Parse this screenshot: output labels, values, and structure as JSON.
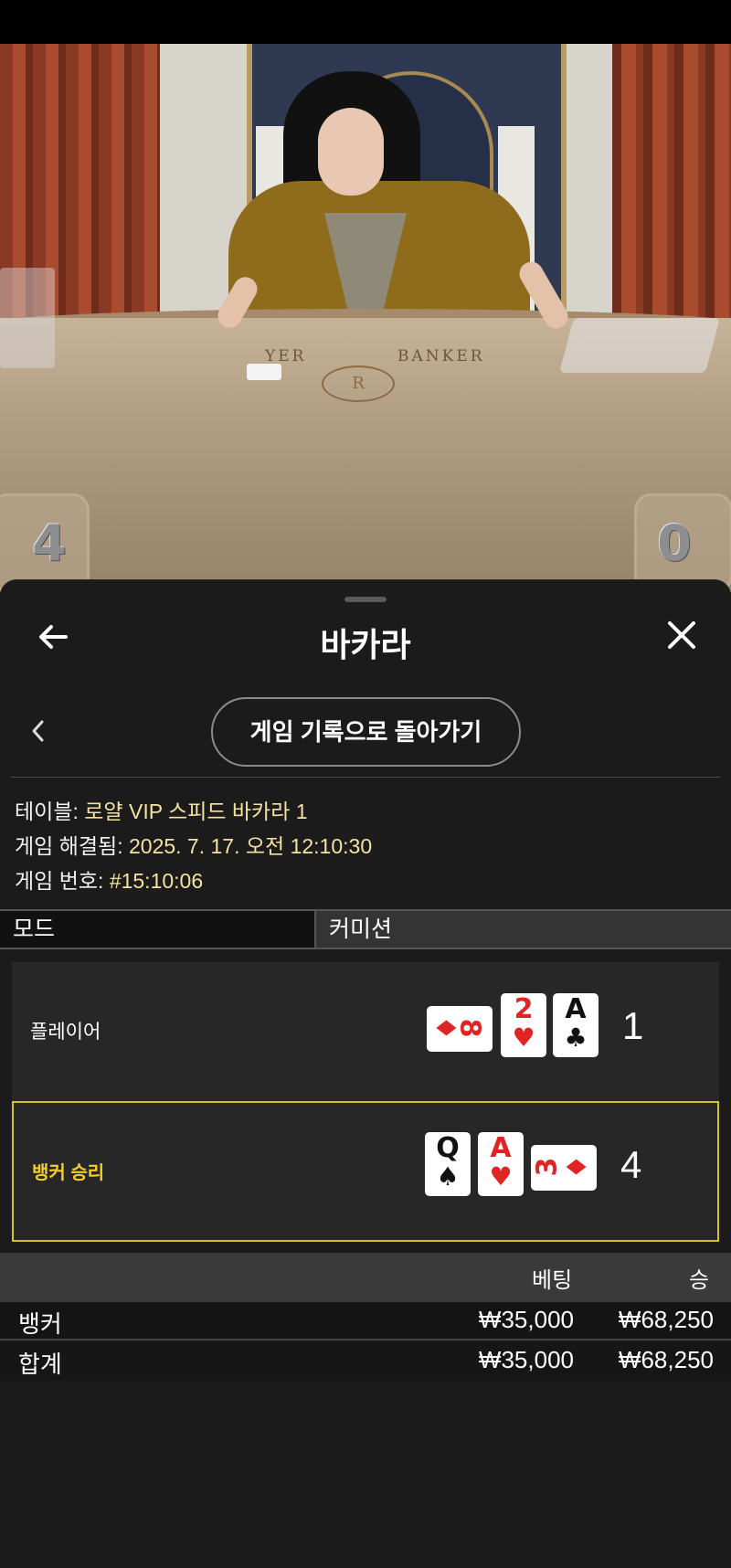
{
  "video": {
    "felt_player_label": "YER",
    "felt_banker_label": "BANKER",
    "felt_logo": "R",
    "left_score": "4",
    "right_score": "0"
  },
  "header": {
    "title": "바카라",
    "back_icon": "arrow-left-icon",
    "close_icon": "close-icon"
  },
  "history": {
    "button_label": "게임 기록으로 돌아가기",
    "chevron_icon": "chevron-left-icon"
  },
  "info": {
    "table_label": "테이블: ",
    "table_value": "로얄 VIP 스피드 바카라 1",
    "resolved_label": "게임 해결됨: ",
    "resolved_value": "2025. 7. 17. 오전 12:10:30",
    "game_no_label": "게임 번호: ",
    "game_no_value": "#15:10:06"
  },
  "mode": {
    "label": "모드",
    "value": "커미션"
  },
  "hands": {
    "player": {
      "label": "플레이어",
      "total": "1",
      "cards": [
        {
          "rank": "8",
          "suit": "♦",
          "color": "#e02424",
          "orientation": "sideways"
        },
        {
          "rank": "2",
          "suit": "♥",
          "color": "#e02424",
          "orientation": "upright"
        },
        {
          "rank": "A",
          "suit": "♣",
          "color": "#111111",
          "orientation": "upright"
        }
      ]
    },
    "banker": {
      "label": "뱅커 승리",
      "total": "4",
      "highlight_color": "#d8bf28",
      "cards": [
        {
          "rank": "Q",
          "suit": "♠",
          "color": "#111111",
          "orientation": "upright"
        },
        {
          "rank": "A",
          "suit": "♥",
          "color": "#e02424",
          "orientation": "upright"
        },
        {
          "rank": "3",
          "suit": "♦",
          "color": "#e02424",
          "orientation": "sideways"
        }
      ]
    }
  },
  "bets": {
    "headers": {
      "bet": "베팅",
      "win": "승"
    },
    "rows": [
      {
        "name": "뱅커",
        "bet": "₩35,000",
        "win": "₩68,250"
      },
      {
        "name": "합계",
        "bet": "₩35,000",
        "win": "₩68,250"
      }
    ]
  }
}
